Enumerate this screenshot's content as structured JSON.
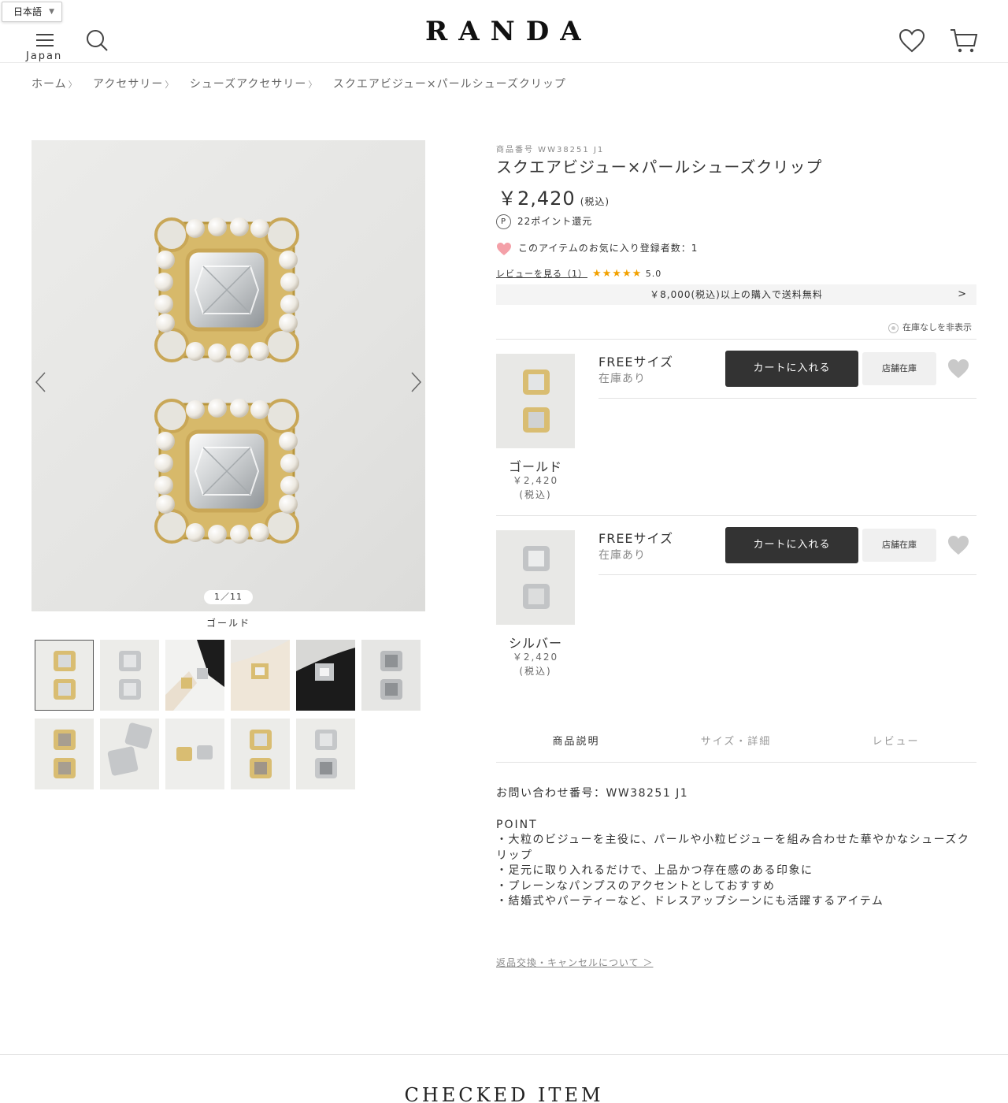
{
  "header": {
    "language": "日本語",
    "region": "Japan",
    "logo": "RANDA"
  },
  "breadcrumb": [
    "ホーム",
    "アクセサリー",
    "シューズアクセサリー",
    "スクエアビジュー×パールシューズクリップ"
  ],
  "gallery": {
    "counter": "1／11",
    "caption": "ゴールド",
    "thumbnail_count": 11
  },
  "product": {
    "sku": "商品番号 WW38251 J1",
    "title": "スクエアビジュー×パールシューズクリップ",
    "price": "￥2,420",
    "tax": "(税込)",
    "points": "22ポイント還元",
    "points_badge": "P",
    "favorites": "このアイテムのお気に入り登録者数：1",
    "review_link": "レビューを見る（1）",
    "stars": "★★★★★",
    "rating": "5.0",
    "shipping": "￥8,000(税込)以上の購入で送料無料",
    "hide_out_of_stock": "在庫なしを非表示"
  },
  "variants": [
    {
      "color": "ゴールド",
      "price": "￥2,420",
      "tax": "(税込)",
      "size": "FREEサイズ",
      "stock": "在庫あり",
      "cart_label": "カートに入れる",
      "store_label": "店舗在庫"
    },
    {
      "color": "シルバー",
      "price": "￥2,420",
      "tax": "(税込)",
      "size": "FREEサイズ",
      "stock": "在庫あり",
      "cart_label": "カートに入れる",
      "store_label": "店舗在庫"
    }
  ],
  "tabs": [
    "商品説明",
    "サイズ・詳細",
    "レビュー"
  ],
  "description": {
    "inquiry": "お問い合わせ番号：WW38251 J1",
    "point_heading": "POINT",
    "points": [
      "・大粒のビジューを主役に、パールや小粒ビジューを組み合わせた華やかなシューズクリップ",
      "・足元に取り入れるだけで、上品かつ存在感のある印象に",
      "・プレーンなパンプスのアクセントとしておすすめ",
      "・結婚式やパーティーなど、ドレスアップシーンにも活躍するアイテム"
    ],
    "return_link": "返品交換・キャンセルについて ＞"
  },
  "checked_item": "CHECKED ITEM",
  "colors": {
    "accent": "#333333",
    "star": "#f2a100",
    "heart": "#f4a0a8"
  }
}
